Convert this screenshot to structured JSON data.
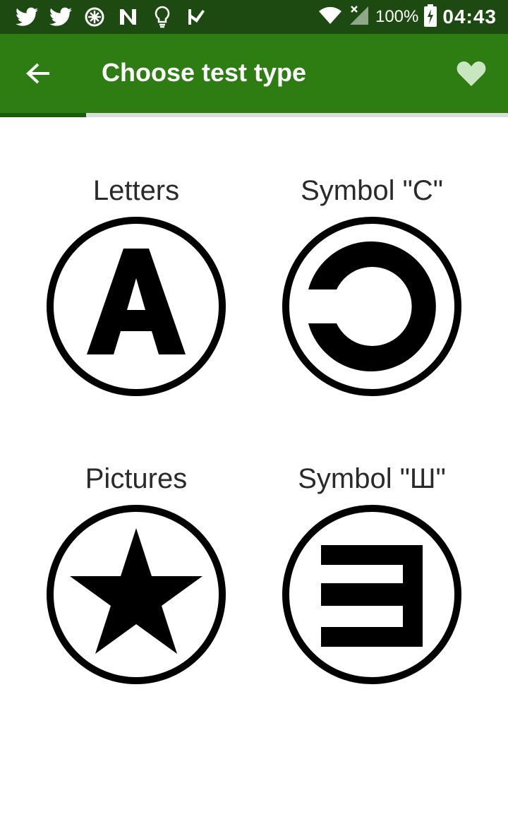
{
  "status_bar": {
    "icons": [
      "twitter-icon",
      "twitter-icon",
      "no-sync-icon",
      "n-app-icon",
      "lightbulb-icon",
      "check-flag-icon"
    ],
    "battery": "100%",
    "time": "04:43"
  },
  "app_bar": {
    "title": "Choose test type",
    "back_icon": "arrow-left-icon",
    "action_icon": "heart-icon"
  },
  "progress": {
    "value": 0.17
  },
  "tiles": [
    {
      "label": "Letters",
      "icon": "letter-a-icon"
    },
    {
      "label": "Symbol \"C\"",
      "icon": "landolt-c-icon"
    },
    {
      "label": "Pictures",
      "icon": "star-icon"
    },
    {
      "label": "Symbol \"Ш\"",
      "icon": "tumbling-e-icon"
    }
  ],
  "colors": {
    "status_bar": "#1c4a10",
    "app_bar": "#2e7d12",
    "progress": "#1b5a0d",
    "heart": "#c8e6c0"
  }
}
